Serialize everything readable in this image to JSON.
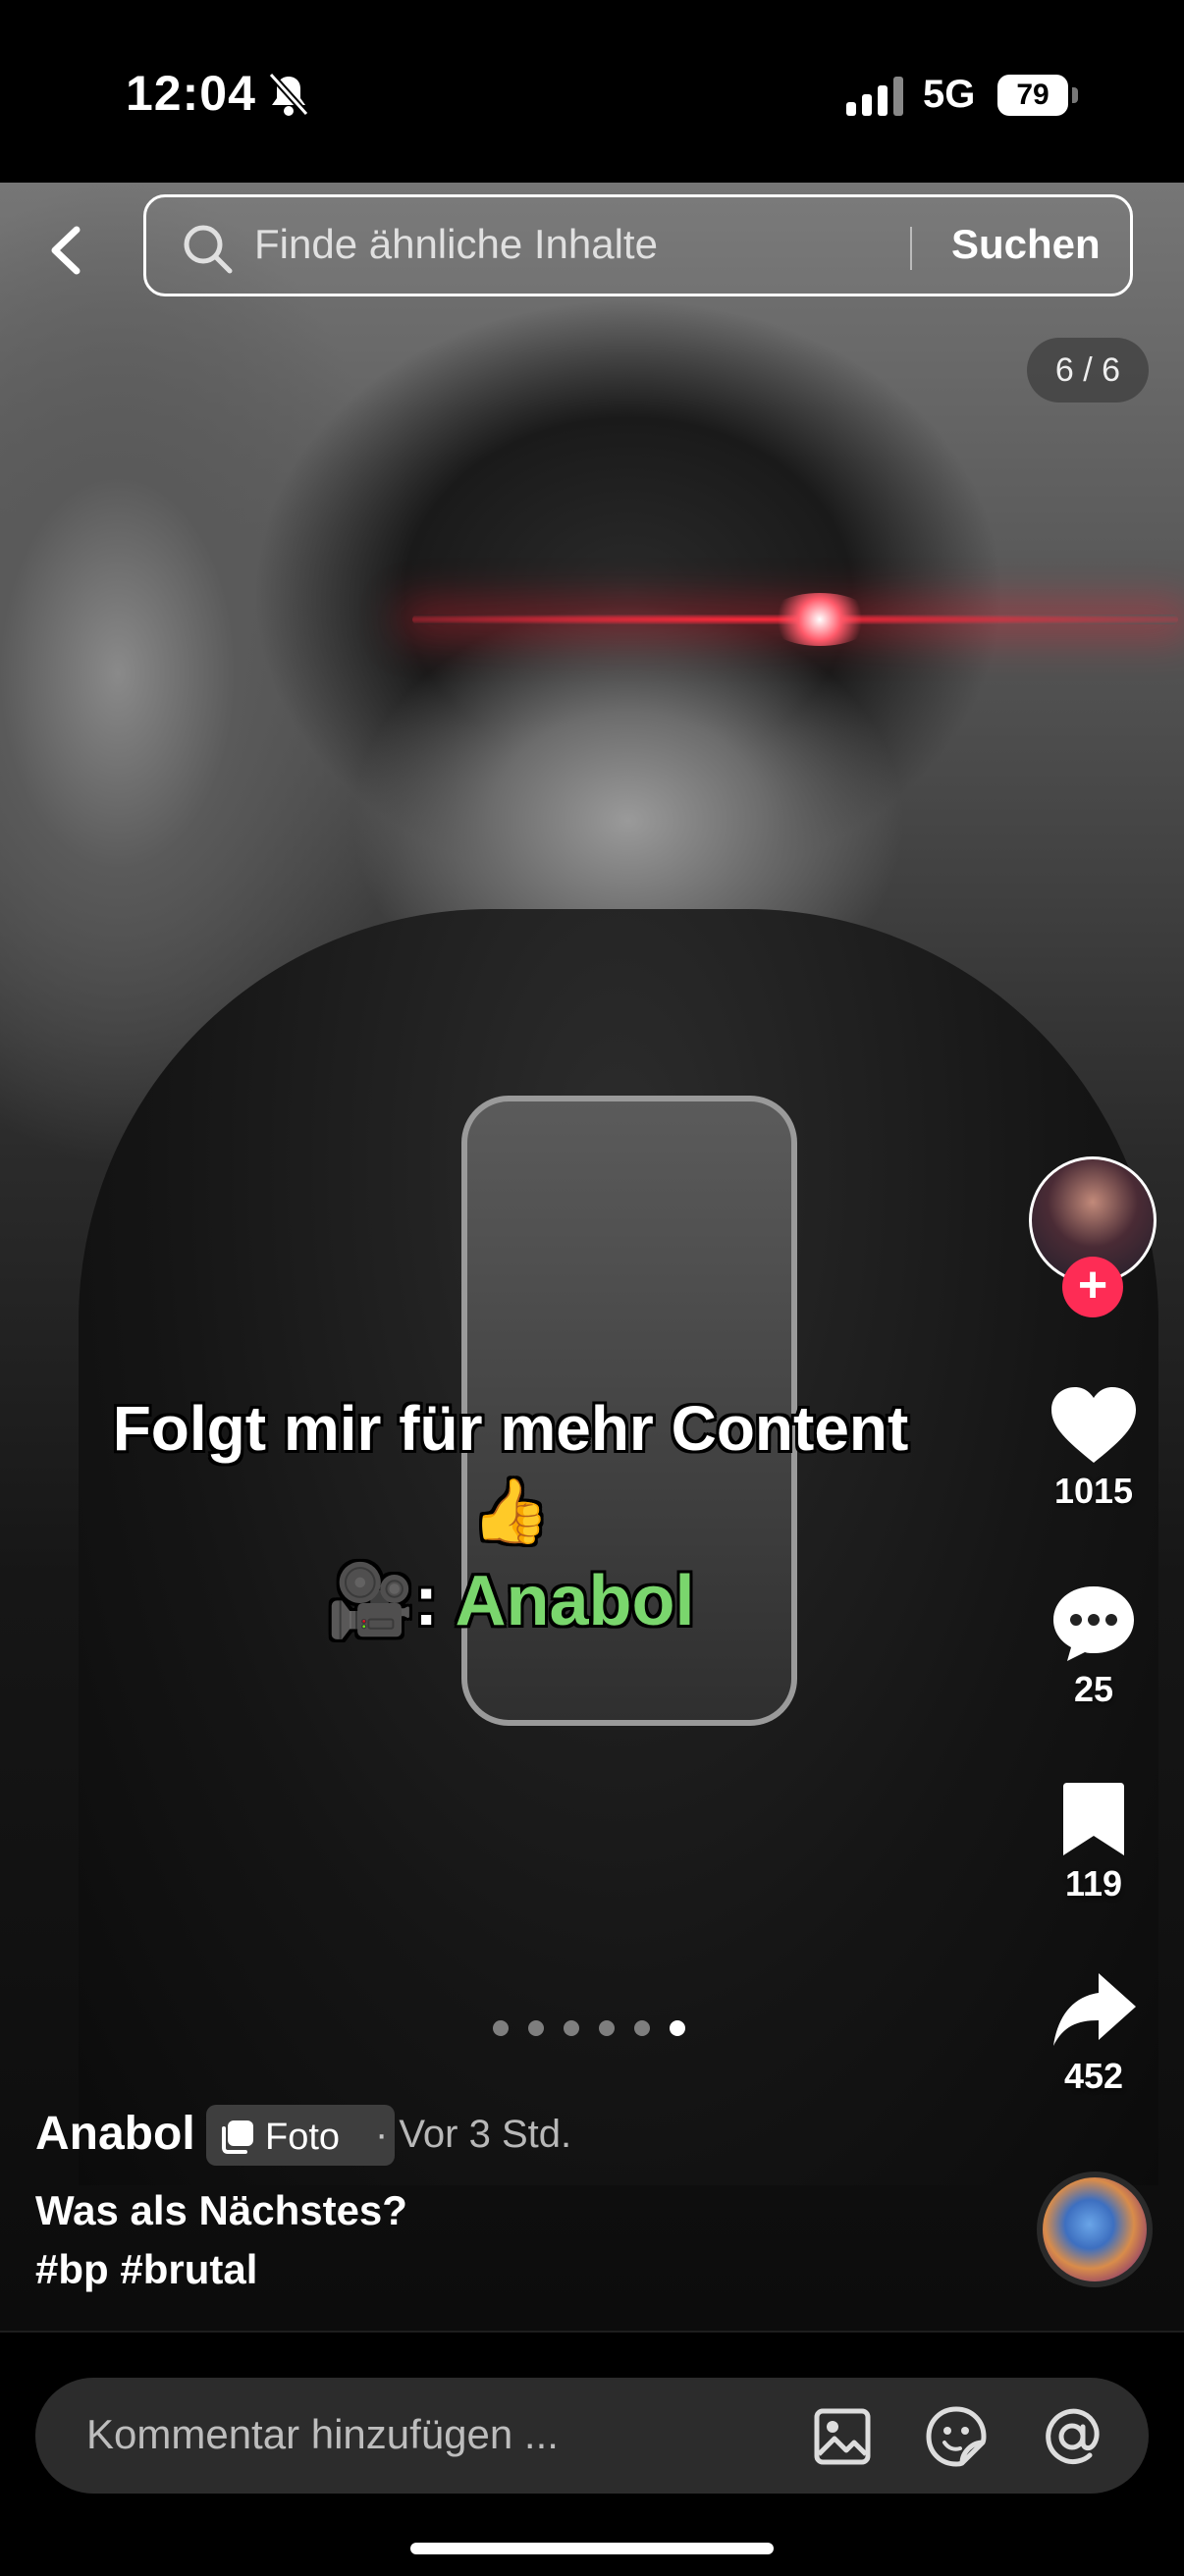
{
  "status": {
    "time": "12:04",
    "network": "5G",
    "battery": "79"
  },
  "search": {
    "placeholder": "Finde ähnliche Inhalte",
    "button": "Suchen"
  },
  "counter": "6 / 6",
  "overlay": {
    "line1": "Folgt mir für mehr Content",
    "line2": "👍",
    "line3_prefix": "🎥: ",
    "line3_name": "Anabol"
  },
  "actions": {
    "likes": "1015",
    "comments": "25",
    "saves": "119",
    "shares": "452"
  },
  "post": {
    "author": "Anabol",
    "badge": "Foto",
    "time_ago": "· Vor 3 Std.",
    "caption": "Was als Nächstes?",
    "hashtags": "#bp #brutal",
    "slide_count": 6,
    "active_slide": 6
  },
  "comment_bar": {
    "placeholder": "Kommentar hinzufügen ..."
  },
  "icons": [
    "bell-off-icon",
    "signal-icon",
    "battery-icon",
    "back-icon",
    "search-icon",
    "heart-icon",
    "comment-icon",
    "bookmark-icon",
    "share-icon",
    "image-icon",
    "sticker-icon",
    "at-icon"
  ],
  "colors": {
    "follow": "#fe2c55",
    "credit": "#7ad66d"
  }
}
